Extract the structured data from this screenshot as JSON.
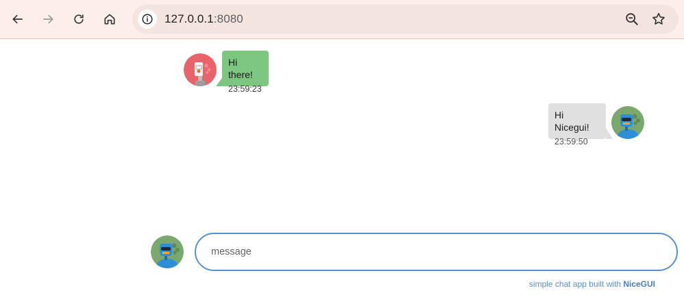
{
  "browser": {
    "url_host": "127.0.0.1",
    "url_port": ":8080",
    "icons": [
      "back-arrow-icon",
      "forward-arrow-icon",
      "reload-icon",
      "home-icon",
      "info-icon",
      "zoom-out-icon",
      "bookmark-star-icon"
    ]
  },
  "chat": {
    "messages": [
      {
        "text": "Hi there!",
        "stamp": "23:59:23",
        "side": "left"
      },
      {
        "text": "Hi Nicegui!",
        "stamp": "23:59:50",
        "side": "right"
      }
    ],
    "input": {
      "placeholder": "message",
      "value": ""
    },
    "footer": {
      "prefix": "simple chat app built with ",
      "link": "NiceGUI"
    }
  },
  "colors": {
    "toolbar_bg": "#fcefea",
    "omnibox_bg": "#f3e4df",
    "sent_bubble": "#7cc67f",
    "received_bubble": "#e0e0e0",
    "input_border": "#5a8fcf",
    "avatar_red": "#e9636b",
    "avatar_green": "#7aa86f"
  }
}
